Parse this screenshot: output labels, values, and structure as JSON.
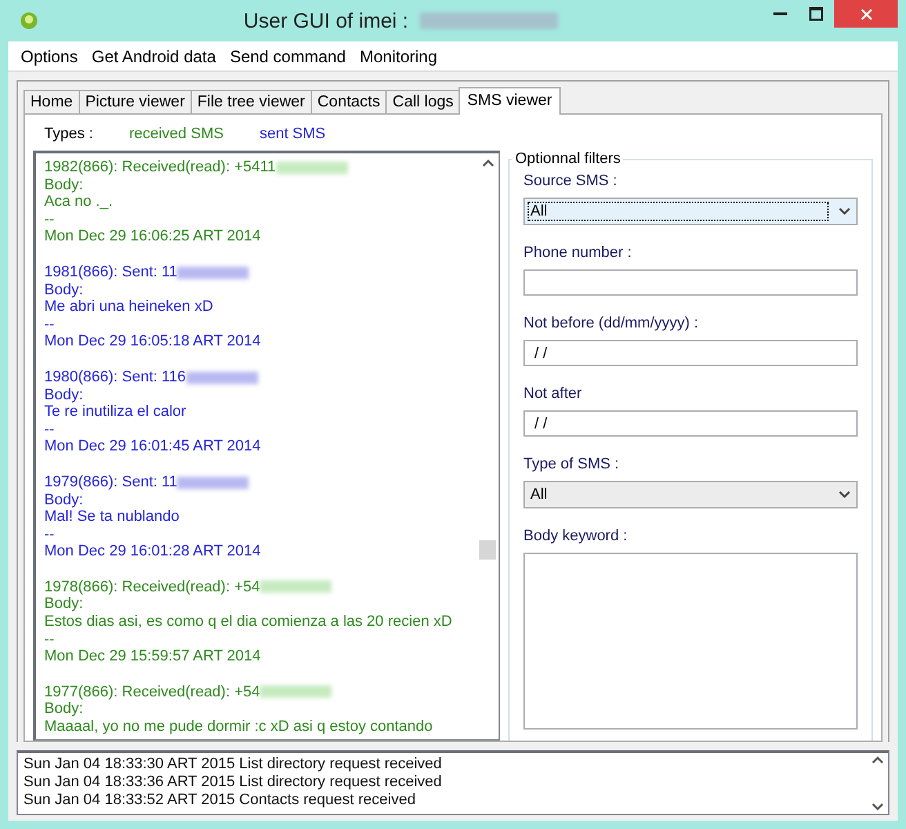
{
  "window": {
    "title": "User GUI of imei :",
    "title_redacted": true
  },
  "menu": [
    "Options",
    "Get Android data",
    "Send command",
    "Monitoring"
  ],
  "tabs": [
    {
      "label": "Home",
      "selected": false
    },
    {
      "label": "Picture viewer",
      "selected": false
    },
    {
      "label": "File tree viewer",
      "selected": false
    },
    {
      "label": "Contacts",
      "selected": false
    },
    {
      "label": "Call logs",
      "selected": false
    },
    {
      "label": "SMS viewer",
      "selected": true
    }
  ],
  "types": {
    "label": "Types :",
    "items": [
      {
        "label": "received SMS",
        "kind": "received"
      },
      {
        "label": "sent SMS",
        "kind": "sent"
      }
    ]
  },
  "messages": [
    {
      "kind": "received",
      "header": "1982(866): Received(read): +5411",
      "redacted": true,
      "body_label": "Body:",
      "body": "Aca no ._.",
      "separator": "--",
      "date": "Mon Dec 29 16:06:25 ART 2014"
    },
    {
      "kind": "sent",
      "header": "1981(866): Sent: 11",
      "redacted": true,
      "body_label": "Body:",
      "body": "Me abri una heineken xD",
      "separator": "--",
      "date": "Mon Dec 29 16:05:18 ART 2014"
    },
    {
      "kind": "sent",
      "header": "1980(866): Sent: 116",
      "redacted": true,
      "body_label": "Body:",
      "body": "Te re inutiliza el calor",
      "separator": "--",
      "date": "Mon Dec 29 16:01:45 ART 2014"
    },
    {
      "kind": "sent",
      "header": "1979(866): Sent: 11",
      "redacted": true,
      "body_label": "Body:",
      "body": "Mal! Se ta nublando",
      "separator": "--",
      "date": "Mon Dec 29 16:01:28 ART 2014"
    },
    {
      "kind": "received",
      "header": "1978(866): Received(read): +54",
      "redacted": true,
      "body_label": "Body:",
      "body": "Estos dias asi, es como q el dia comienza a las 20  recien xD",
      "separator": "--",
      "date": "Mon Dec 29 15:59:57 ART 2014"
    },
    {
      "kind": "received",
      "header": "1977(866): Received(read): +54",
      "redacted": true,
      "body_label": "Body:",
      "body": "Maaaal, yo no me pude dormir :c xD asi q estoy contando"
    }
  ],
  "filters": {
    "title": "Optionnal filters",
    "fields": [
      {
        "kind": "select",
        "label": "Source SMS :",
        "value": "All",
        "focused": true
      },
      {
        "kind": "text",
        "label": "Phone number :"
      },
      {
        "kind": "text",
        "label": "Not before (dd/mm/yyyy)  :",
        "value": " / /"
      },
      {
        "kind": "text",
        "label": "Not after",
        "value": " / /"
      },
      {
        "kind": "select",
        "label": "Type of SMS :",
        "value": "All",
        "focused": false
      },
      {
        "kind": "textarea",
        "label": "Body keyword :"
      }
    ]
  },
  "log": [
    "Sun Jan 04 18:33:30 ART 2015 List directory request received",
    "Sun Jan 04 18:33:36 ART 2015 List directory request received",
    "Sun Jan 04 18:33:52 ART 2015 Contacts request received"
  ]
}
